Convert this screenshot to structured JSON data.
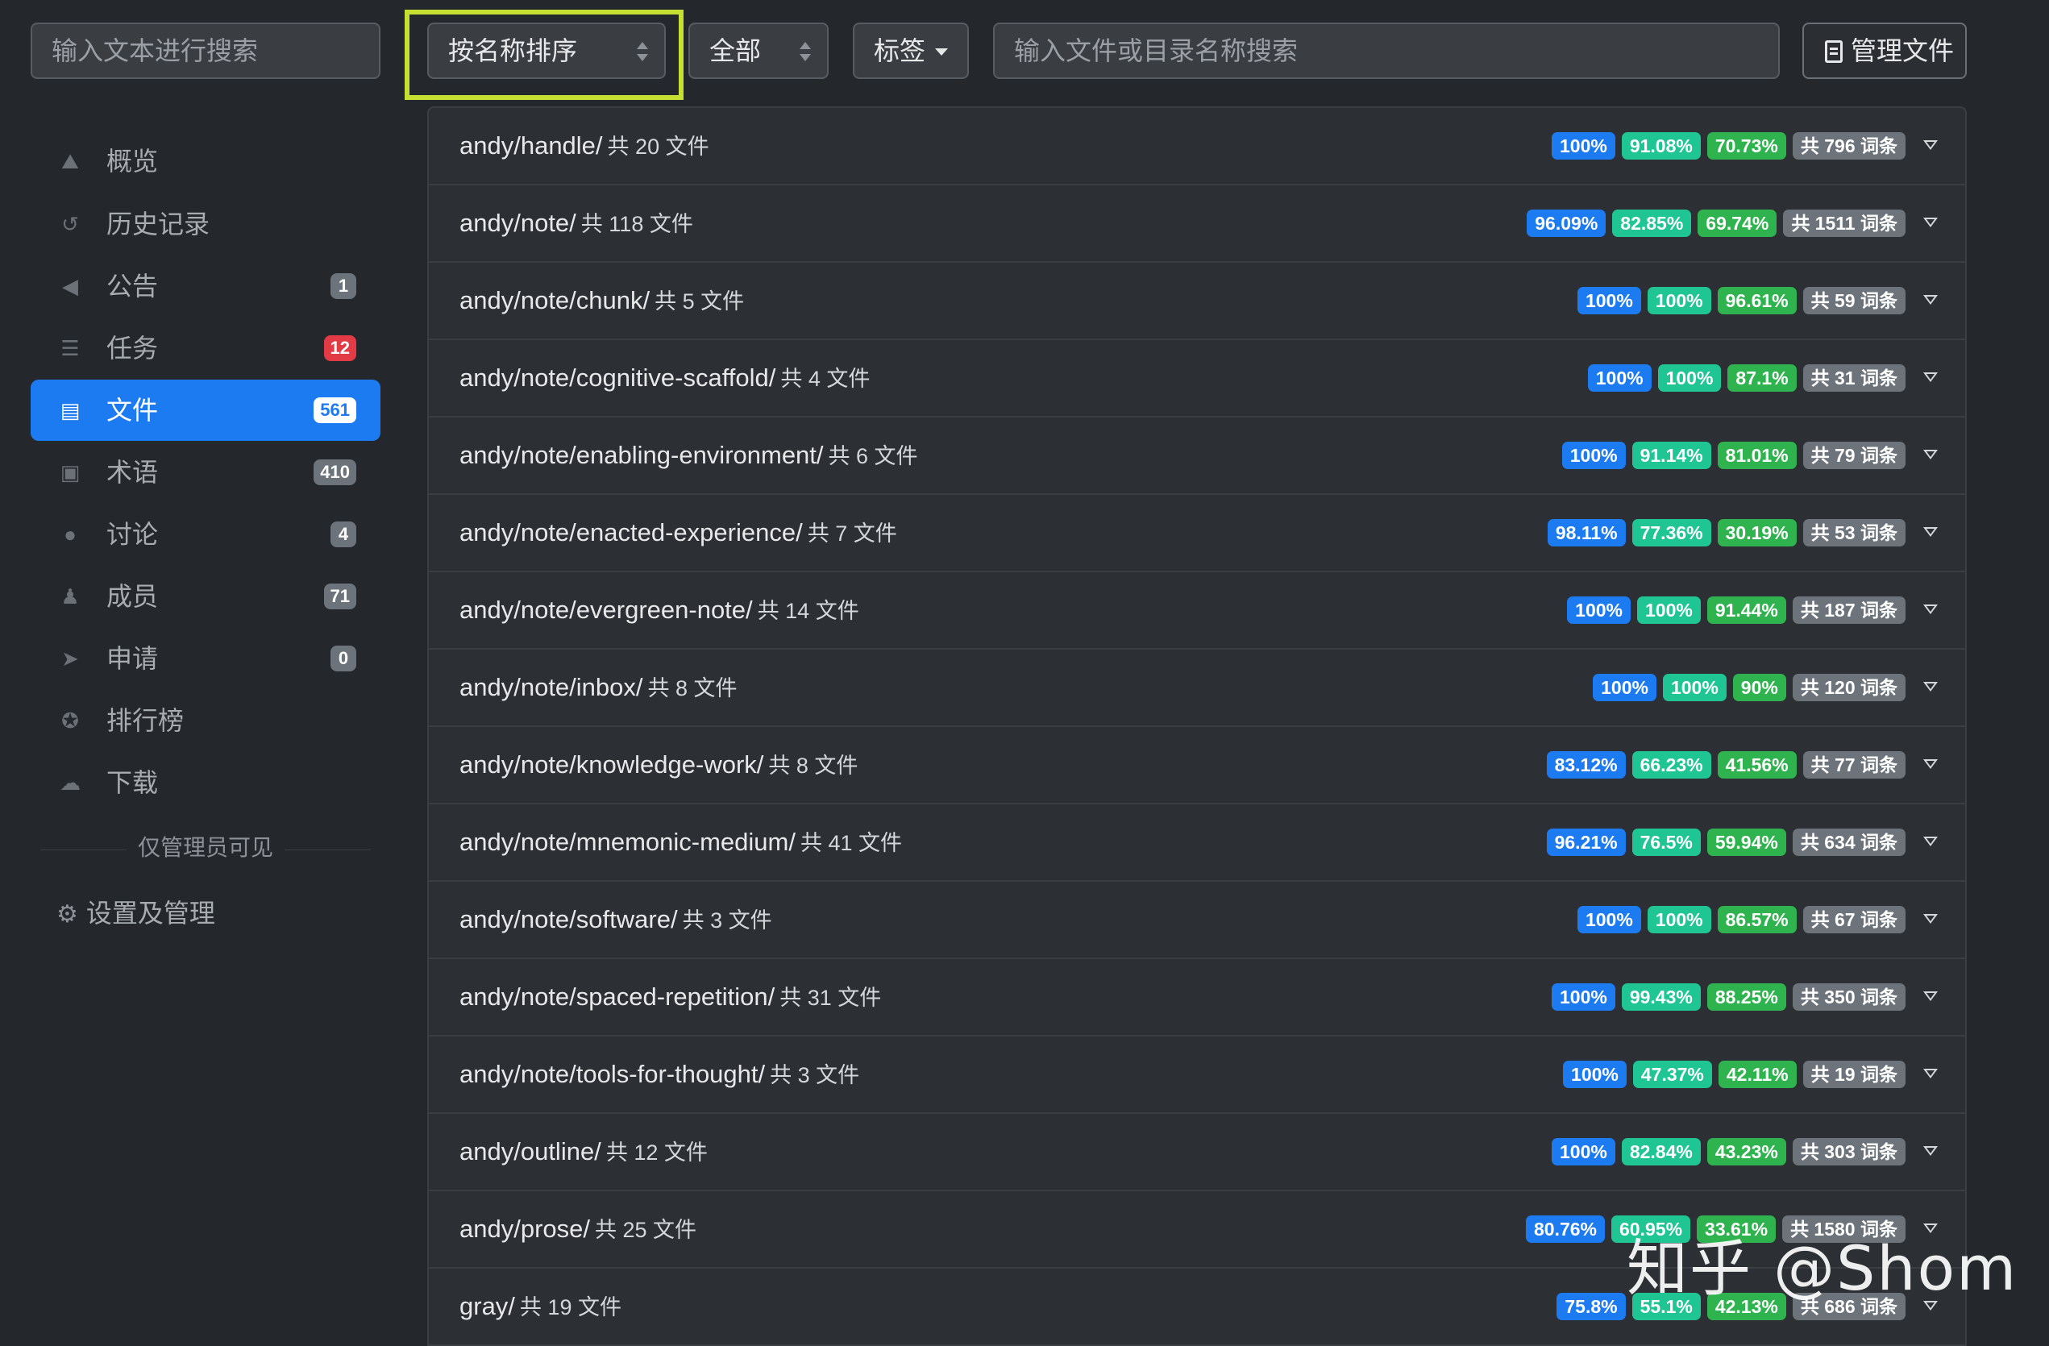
{
  "toolbar": {
    "text_search_placeholder": "输入文本进行搜索",
    "sort_value": "按名称排序",
    "filter_value": "全部",
    "tag_label": "标签",
    "file_search_placeholder": "输入文件或目录名称搜索",
    "manage_label": "管理文件"
  },
  "sidebar": {
    "items": [
      {
        "label": "概览",
        "icon": "chart-icon"
      },
      {
        "label": "历史记录",
        "icon": "history-icon"
      },
      {
        "label": "公告",
        "icon": "megaphone-icon",
        "badge": "1"
      },
      {
        "label": "任务",
        "icon": "tasks-icon",
        "badge": "12"
      },
      {
        "label": "文件",
        "icon": "file-icon",
        "badge": "561",
        "active": true
      },
      {
        "label": "术语",
        "icon": "glossary-icon",
        "badge": "410"
      },
      {
        "label": "讨论",
        "icon": "comments-icon",
        "badge": "4"
      },
      {
        "label": "成员",
        "icon": "users-icon",
        "badge": "71"
      },
      {
        "label": "申请",
        "icon": "paper-plane-icon",
        "badge": "0"
      },
      {
        "label": "排行榜",
        "icon": "medal-icon"
      },
      {
        "label": "下载",
        "icon": "cloud-download-icon"
      }
    ],
    "admin_note": "仅管理员可见",
    "settings_label": "设置及管理"
  },
  "colors": {
    "accent": "#1d7bf2",
    "translated": "#1fc593",
    "approved": "#2fb34e",
    "neutral": "#6c737a",
    "danger": "#e23b45",
    "highlight": "#c5e033"
  },
  "directories": [
    {
      "path": "andy/handle/",
      "count": "共 20 文件",
      "p1": "100%",
      "p2": "91.08%",
      "p3": "70.73%",
      "terms": "共 796 词条"
    },
    {
      "path": "andy/note/",
      "count": "共 118 文件",
      "p1": "96.09%",
      "p2": "82.85%",
      "p3": "69.74%",
      "terms": "共 1511 词条"
    },
    {
      "path": "andy/note/chunk/",
      "count": "共 5 文件",
      "p1": "100%",
      "p2": "100%",
      "p3": "96.61%",
      "terms": "共 59 词条"
    },
    {
      "path": "andy/note/cognitive-scaffold/",
      "count": "共 4 文件",
      "p1": "100%",
      "p2": "100%",
      "p3": "87.1%",
      "terms": "共 31 词条"
    },
    {
      "path": "andy/note/enabling-environment/",
      "count": "共 6 文件",
      "p1": "100%",
      "p2": "91.14%",
      "p3": "81.01%",
      "terms": "共 79 词条"
    },
    {
      "path": "andy/note/enacted-experience/",
      "count": "共 7 文件",
      "p1": "98.11%",
      "p2": "77.36%",
      "p3": "30.19%",
      "terms": "共 53 词条"
    },
    {
      "path": "andy/note/evergreen-note/",
      "count": "共 14 文件",
      "p1": "100%",
      "p2": "100%",
      "p3": "91.44%",
      "terms": "共 187 词条"
    },
    {
      "path": "andy/note/inbox/",
      "count": "共 8 文件",
      "p1": "100%",
      "p2": "100%",
      "p3": "90%",
      "terms": "共 120 词条"
    },
    {
      "path": "andy/note/knowledge-work/",
      "count": "共 8 文件",
      "p1": "83.12%",
      "p2": "66.23%",
      "p3": "41.56%",
      "terms": "共 77 词条"
    },
    {
      "path": "andy/note/mnemonic-medium/",
      "count": "共 41 文件",
      "p1": "96.21%",
      "p2": "76.5%",
      "p3": "59.94%",
      "terms": "共 634 词条"
    },
    {
      "path": "andy/note/software/",
      "count": "共 3 文件",
      "p1": "100%",
      "p2": "100%",
      "p3": "86.57%",
      "terms": "共 67 词条"
    },
    {
      "path": "andy/note/spaced-repetition/",
      "count": "共 31 文件",
      "p1": "100%",
      "p2": "99.43%",
      "p3": "88.25%",
      "terms": "共 350 词条"
    },
    {
      "path": "andy/note/tools-for-thought/",
      "count": "共 3 文件",
      "p1": "100%",
      "p2": "47.37%",
      "p3": "42.11%",
      "terms": "共 19 词条"
    },
    {
      "path": "andy/outline/",
      "count": "共 12 文件",
      "p1": "100%",
      "p2": "82.84%",
      "p3": "43.23%",
      "terms": "共 303 词条"
    },
    {
      "path": "andy/prose/",
      "count": "共 25 文件",
      "p1": "80.76%",
      "p2": "60.95%",
      "p3": "33.61%",
      "terms": "共 1580 词条"
    },
    {
      "path": "gray/",
      "count": "共 19 文件",
      "p1": "75.8%",
      "p2": "55.1%",
      "p3": "42.13%",
      "terms": "共 686 词条"
    }
  ],
  "watermark": "知乎 @Shom"
}
